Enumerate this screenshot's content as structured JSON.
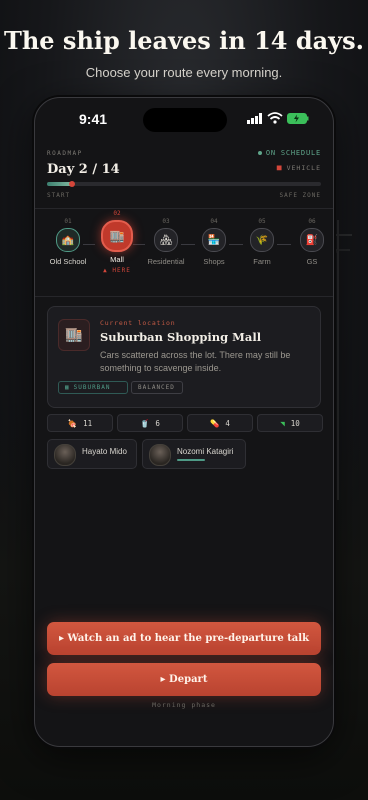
{
  "promo": {
    "headline": "The ship leaves in 14 days.",
    "subhead": "Choose your route every morning."
  },
  "status_bar": {
    "time": "9:41"
  },
  "roadmap": {
    "label": "ROADMAP",
    "day": "Day 2 / 14",
    "status": "ON SCHEDULE",
    "vehicle": "VEHICLE",
    "start_label": "START",
    "end_label": "SAFE ZONE",
    "progress": 0.09
  },
  "route": {
    "stops": [
      {
        "num": "01",
        "name": "Old School",
        "icon": "🏫",
        "state": "done"
      },
      {
        "num": "02",
        "name": "Mall",
        "icon": "🏬",
        "state": "current"
      },
      {
        "num": "03",
        "name": "Residential",
        "icon": "🏘",
        "state": "upcoming"
      },
      {
        "num": "04",
        "name": "Shops",
        "icon": "🏪",
        "state": "upcoming"
      },
      {
        "num": "05",
        "name": "Farm",
        "icon": "🌾",
        "state": "upcoming"
      },
      {
        "num": "06",
        "name": "GS",
        "icon": "⛽",
        "state": "upcoming"
      }
    ],
    "here_label": "▲ HERE"
  },
  "location": {
    "kicker": "Current location",
    "title": "Suburban Shopping Mall",
    "description": "Cars scattered across the lot. There may still be something to scavenge inside.",
    "icon": "🏬",
    "tags": {
      "area": "SUBURBAN",
      "mode": "BALANCED"
    }
  },
  "stats": [
    {
      "icon": "🍖",
      "value": "11"
    },
    {
      "icon": "🥤",
      "value": "6"
    },
    {
      "icon": "💊",
      "value": "4"
    },
    {
      "icon": "◥",
      "value": "10"
    }
  ],
  "characters": [
    {
      "name": "Hayato Mido"
    },
    {
      "name": "Nozomi Katagiri"
    }
  ],
  "actions": {
    "talk": "▸ Watch an ad to hear the pre-departure talk",
    "depart": "▸ Depart",
    "phase": "Morning phase"
  },
  "colors": {
    "accent": "#c94a35",
    "teal": "#4f9a86"
  }
}
